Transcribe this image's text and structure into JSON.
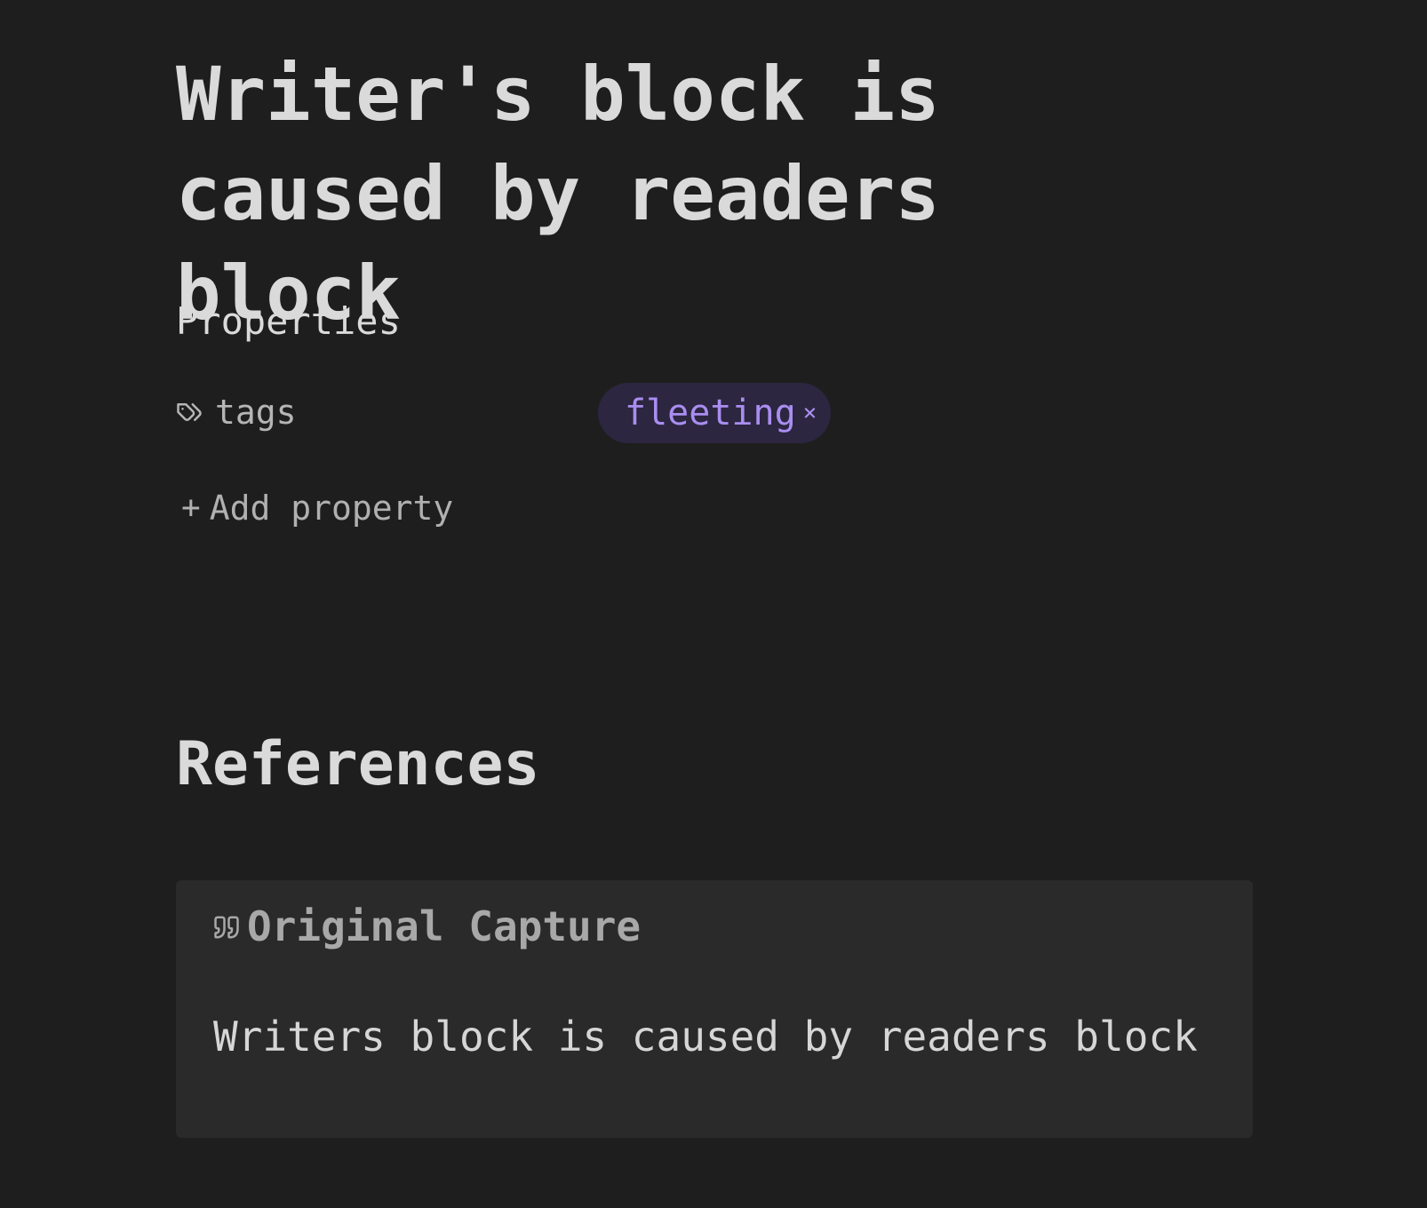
{
  "note": {
    "title": "Writer's block is caused by readers block"
  },
  "properties": {
    "heading": "Properties",
    "items": [
      {
        "icon": "tags-icon",
        "key": "tags",
        "values": [
          {
            "label": "fleeting",
            "remove": "×"
          }
        ]
      }
    ],
    "add_label": "Add property",
    "add_icon": "+"
  },
  "references": {
    "heading": "References",
    "callout": {
      "icon": "quote-icon",
      "title": "Original Capture",
      "body": "Writers block is caused by readers block"
    }
  },
  "colors": {
    "background": "#1e1e1e",
    "callout_background": "#2a2a2a",
    "tag_background": "#2c2640",
    "tag_text": "#a98ef0"
  }
}
